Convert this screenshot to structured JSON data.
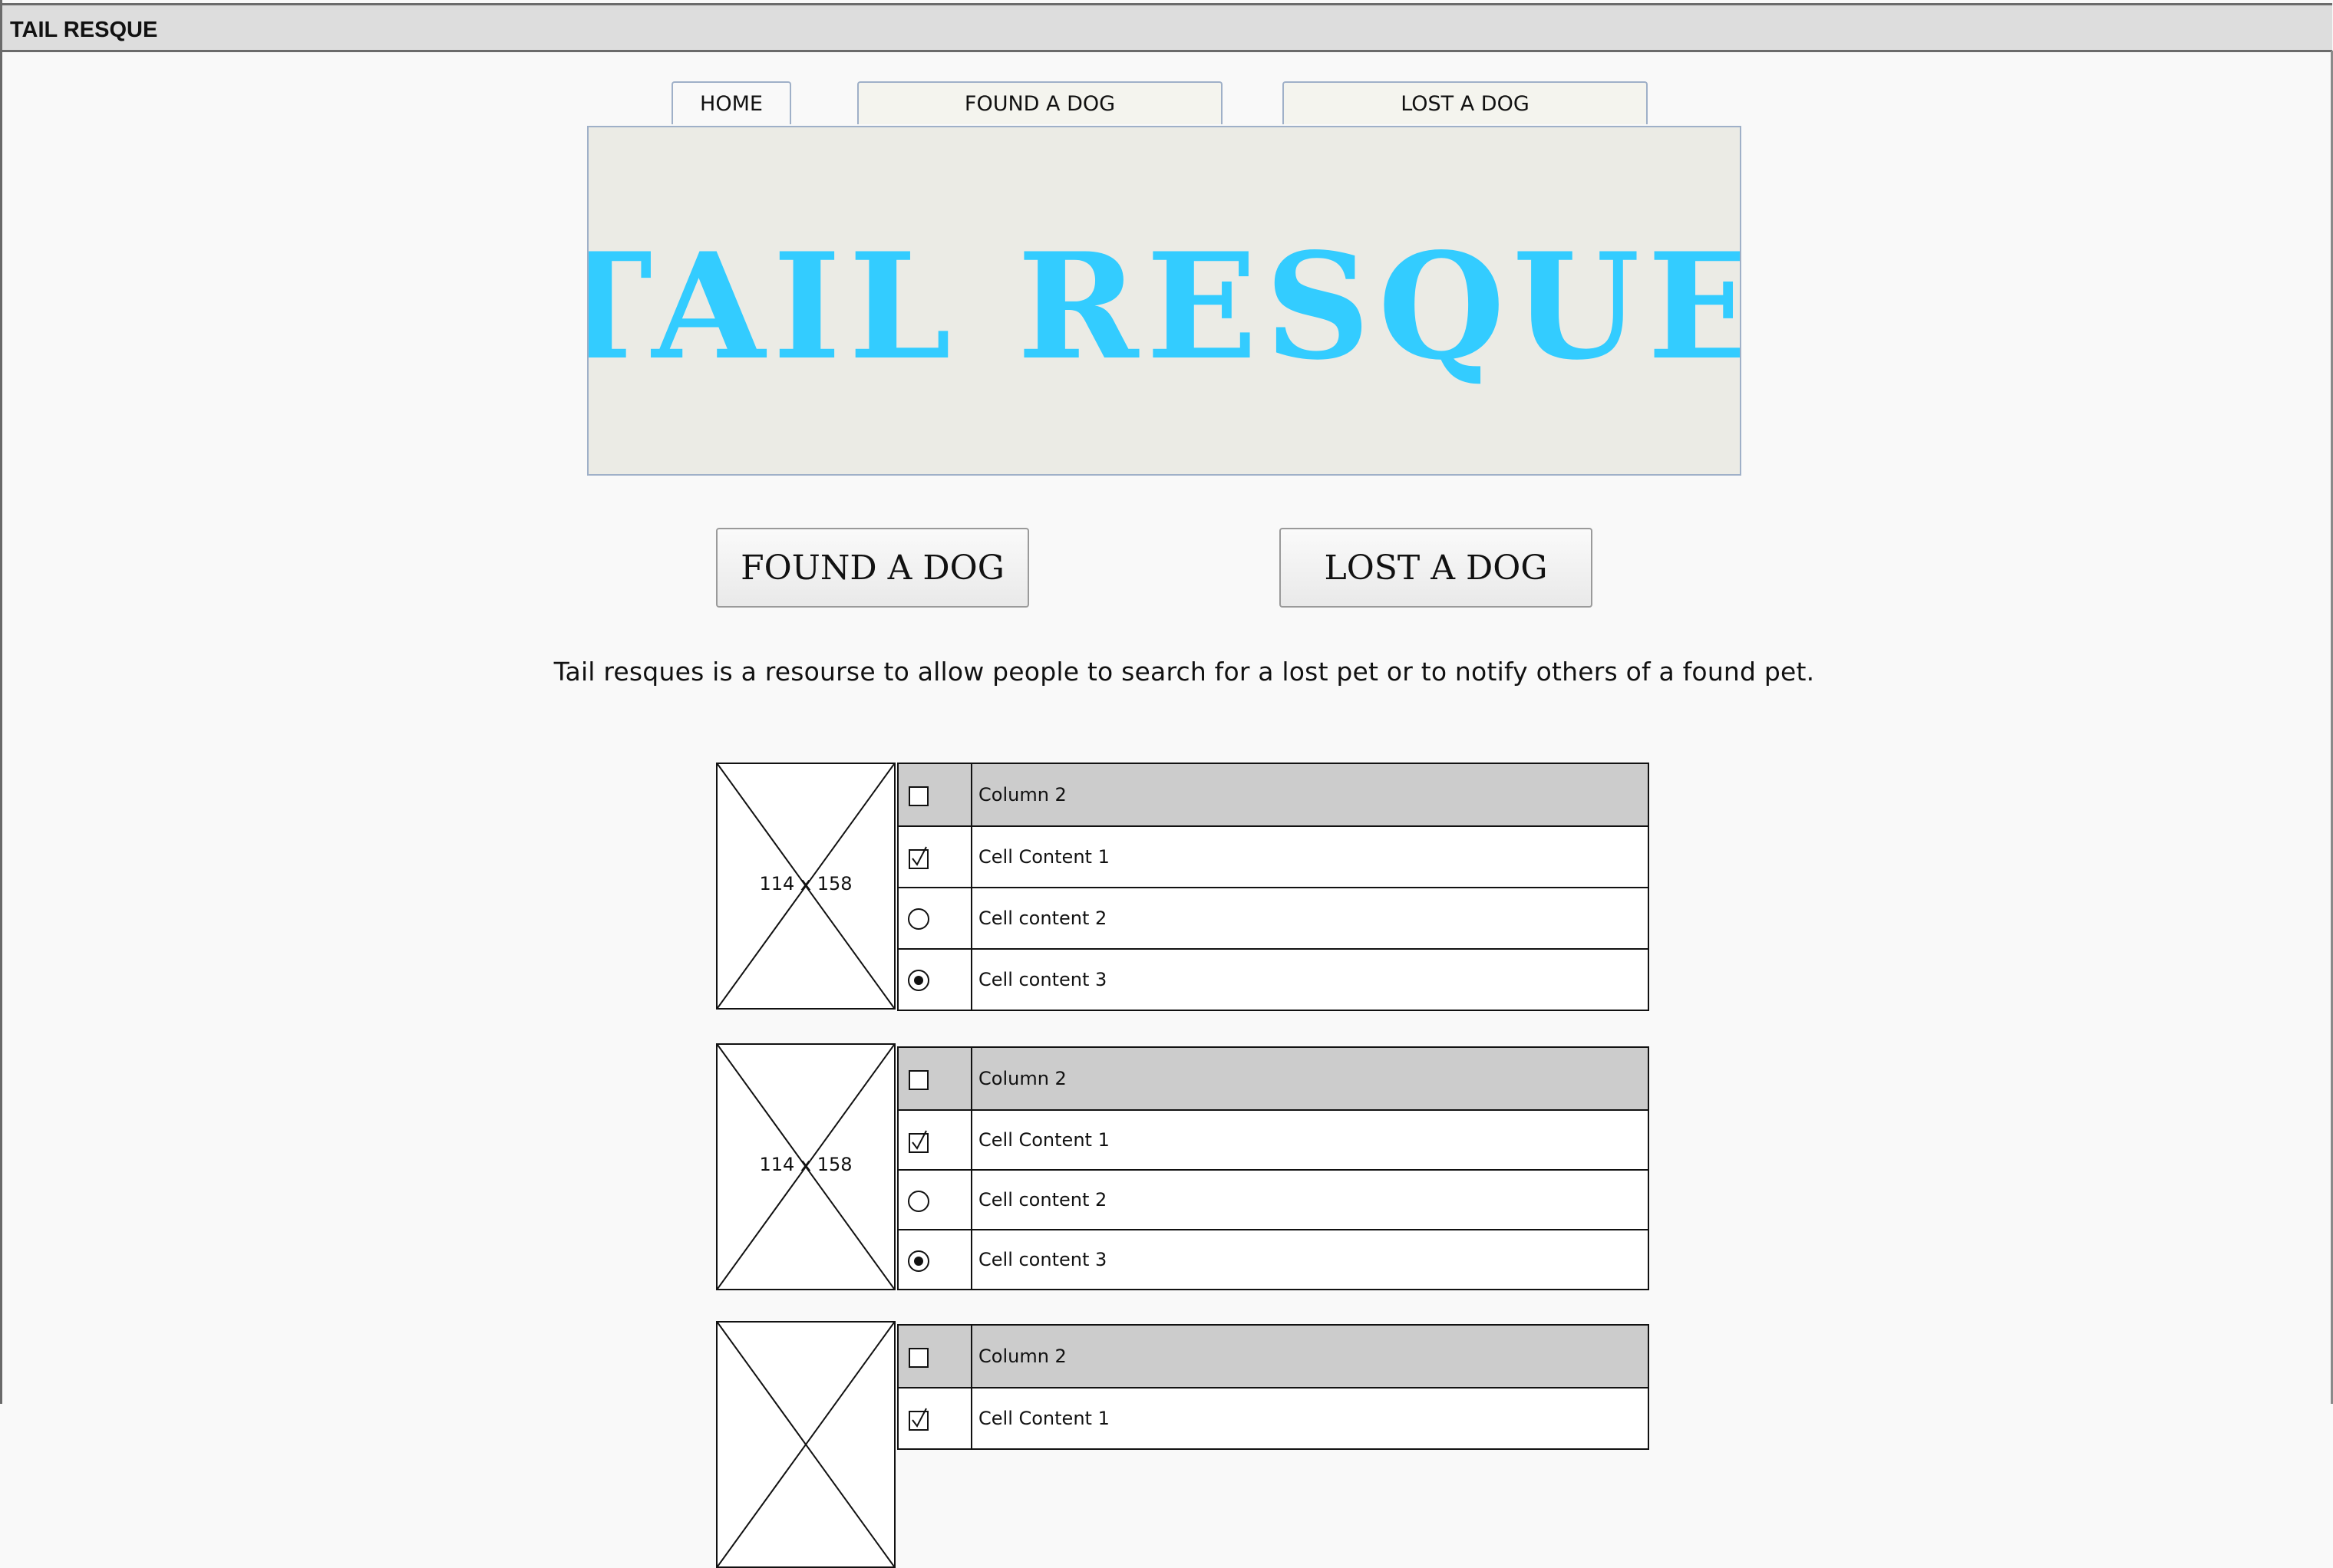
{
  "window": {
    "title": "TAIL RESQUE"
  },
  "tabs": [
    {
      "label": "HOME"
    },
    {
      "label": "FOUND A DOG"
    },
    {
      "label": "LOST A DOG"
    }
  ],
  "banner": {
    "logo_text": "TAIL RESQUE",
    "logo_color": "#33ccff"
  },
  "actions": {
    "found_label": "FOUND A DOG",
    "lost_label": "LOST A DOG"
  },
  "description": "Tail resques is a resourse to allow people to search for a lost pet or to notify others of a found pet.",
  "records": [
    {
      "image_label": "114 x 158",
      "header": "Column 2",
      "rows": [
        {
          "text": "Cell Content 1",
          "control": "checkbox-checked"
        },
        {
          "text": "Cell content 2",
          "control": "radio-unselected"
        },
        {
          "text": "Cell content 3",
          "control": "radio-selected"
        }
      ]
    },
    {
      "image_label": "114 x 158",
      "header": "Column 2",
      "rows": [
        {
          "text": "Cell Content 1",
          "control": "checkbox-checked"
        },
        {
          "text": "Cell content 2",
          "control": "radio-unselected"
        },
        {
          "text": "Cell content 3",
          "control": "radio-selected"
        }
      ]
    },
    {
      "header": "Column 2",
      "rows": [
        {
          "text": "Cell Content 1",
          "control": "checkbox-checked"
        }
      ]
    }
  ]
}
